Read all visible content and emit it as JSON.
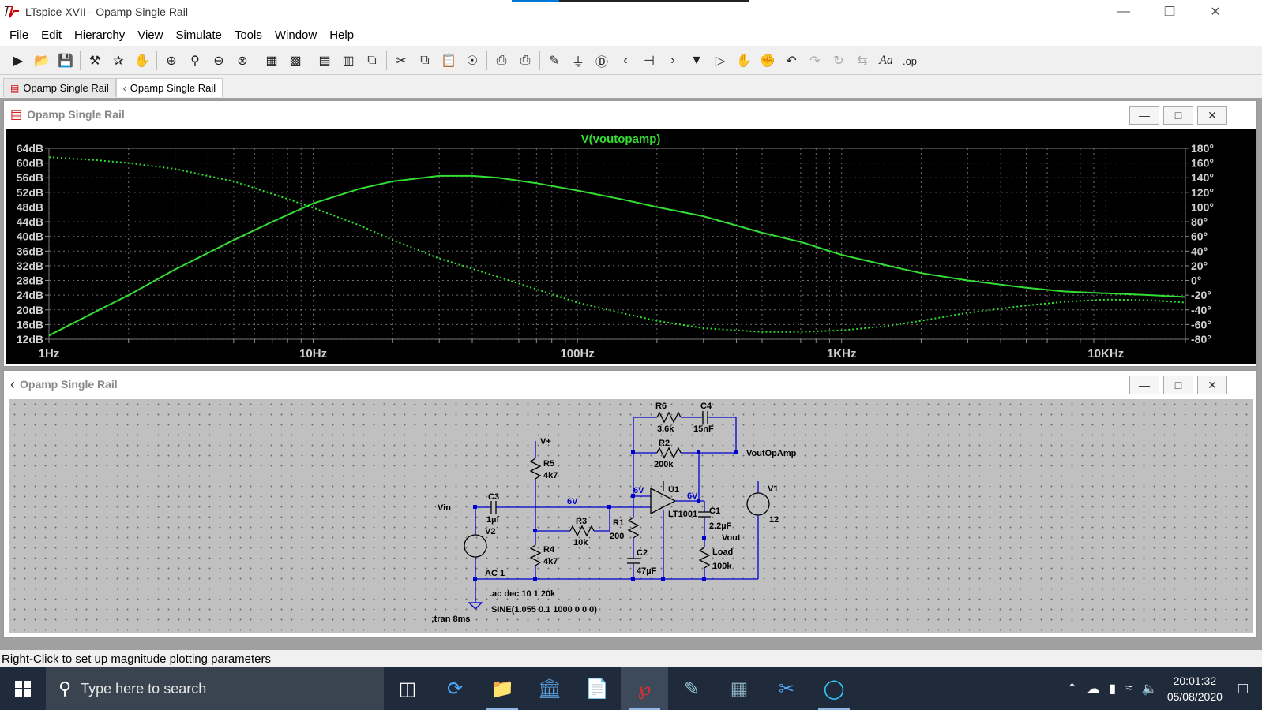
{
  "window": {
    "title": "LTspice XVII - Opamp Single Rail",
    "progress": 0.2
  },
  "menu": [
    "File",
    "Edit",
    "Hierarchy",
    "View",
    "Simulate",
    "Tools",
    "Window",
    "Help"
  ],
  "toolbar_icons": [
    "run-icon",
    "open-icon",
    "save-icon",
    "control-panel-icon",
    "halt-icon",
    "pan-icon",
    "zoom-in-icon",
    "zoom-full-icon",
    "zoom-out-icon",
    "zoom-cancel-icon",
    "autorange-icon",
    "tile-icon",
    "tile-horizontal-icon",
    "tile-vertical-icon",
    "cascade-icon",
    "cut-icon",
    "copy-icon",
    "paste-icon",
    "find-icon",
    "print-preview-icon",
    "print-icon",
    "wire-icon",
    "ground-icon",
    "label-net-icon",
    "resistor-icon",
    "capacitor-icon",
    "inductor-icon",
    "diode-icon",
    "component-icon",
    "move-icon",
    "drag-icon",
    "undo-icon",
    "redo-icon",
    "rotate-icon",
    "mirror-icon",
    "text-icon",
    "spice-directive-icon"
  ],
  "tabs": [
    {
      "label": "Opamp Single Rail",
      "icon": "waveform-tab-icon",
      "active": false
    },
    {
      "label": "Opamp Single Rail",
      "icon": "schematic-tab-icon",
      "active": true
    }
  ],
  "plot_window": {
    "title": "Opamp Single Rail"
  },
  "schematic_window": {
    "title": "Opamp Single Rail"
  },
  "chart_data": {
    "type": "line",
    "title": "V(voutopamp)",
    "x_scale": "log",
    "xlim": [
      1,
      20000
    ],
    "x_tick_labels": [
      "1Hz",
      "10Hz",
      "100Hz",
      "1KHz",
      "10KHz"
    ],
    "x_ticks": [
      1,
      10,
      100,
      1000,
      10000
    ],
    "ylim_left": [
      12,
      64
    ],
    "y_left_labels": [
      "64dB",
      "60dB",
      "56dB",
      "52dB",
      "48dB",
      "44dB",
      "40dB",
      "36dB",
      "32dB",
      "28dB",
      "24dB",
      "20dB",
      "16dB",
      "12dB"
    ],
    "y_left_ticks": [
      64,
      60,
      56,
      52,
      48,
      44,
      40,
      36,
      32,
      28,
      24,
      20,
      16,
      12
    ],
    "ylim_right": [
      -80,
      180
    ],
    "y_right_labels": [
      "180°",
      "160°",
      "140°",
      "120°",
      "100°",
      "80°",
      "60°",
      "40°",
      "20°",
      "0°",
      "-20°",
      "-40°",
      "-60°",
      "-80°"
    ],
    "y_right_ticks": [
      180,
      160,
      140,
      120,
      100,
      80,
      60,
      40,
      20,
      0,
      -20,
      -40,
      -60,
      -80
    ],
    "grid": true,
    "series": [
      {
        "name": "V(voutopamp)",
        "kind": "magnitude (dB)",
        "style": "solid",
        "color": "#33dd33",
        "x": [
          1,
          1.5,
          2,
          3,
          5,
          7,
          10,
          15,
          20,
          30,
          40,
          50,
          70,
          100,
          150,
          200,
          300,
          500,
          700,
          1000,
          1500,
          2000,
          3000,
          5000,
          7000,
          10000,
          15000,
          20000
        ],
        "y": [
          13,
          19.5,
          24,
          31,
          39,
          44,
          49,
          53,
          55,
          56.5,
          56.5,
          56,
          54.5,
          52.5,
          50,
          48,
          45.5,
          41,
          38.5,
          35,
          32,
          30,
          28,
          26,
          25,
          24.5,
          24,
          23.5
        ]
      },
      {
        "name": "V(voutopamp)",
        "kind": "phase (degrees)",
        "style": "dotted",
        "color": "#33dd33",
        "x": [
          1,
          1.5,
          2,
          3,
          5,
          7,
          10,
          15,
          20,
          30,
          50,
          70,
          100,
          150,
          200,
          300,
          500,
          700,
          1000,
          1500,
          2000,
          3000,
          5000,
          7000,
          10000,
          15000,
          20000
        ],
        "y": [
          168,
          164,
          160,
          152,
          135,
          118,
          99,
          75,
          55,
          30,
          5,
          -12,
          -30,
          -45,
          -55,
          -65,
          -70,
          -70,
          -68,
          -62,
          -55,
          -44,
          -34,
          -29,
          -26,
          -27,
          -30
        ]
      }
    ]
  },
  "schematic": {
    "labels": {
      "vin": "Vin",
      "vplus": "V+",
      "vout_opamp": "VoutOpAmp",
      "vout": "Vout",
      "r5": "R5",
      "r5_val": "4k7",
      "r4": "R4",
      "r4_val": "4k7",
      "r3": "R3",
      "r3_val": "10k",
      "r1": "R1",
      "r1_val": "200",
      "r2": "R2",
      "r2_val": "200k",
      "r6": "R6",
      "r6_val": "3.6k",
      "c4": "C4",
      "c4_val": "15nF",
      "c3": "C3",
      "c3_val": "1µf",
      "c2": "C2",
      "c2_val": "47µF",
      "c1": "C1",
      "c1_val": "2.2µF",
      "load": "Load",
      "load_val": "100k",
      "u1": "U1",
      "u1_val": "LT1001",
      "v1": "V1",
      "v1_val": "12",
      "v2": "V2",
      "v2_val": "AC 1",
      "node_6v_a": "6V",
      "node_6v_b": "6V",
      "node_6v_c": "6V",
      "directive_ac": ".ac dec 10 1 20k",
      "directive_sine": "SINE(1.055 0.1 1000 0 0 0)",
      "directive_tran": ";tran 8ms"
    }
  },
  "status": "Right-Click to set up magnitude plotting parameters",
  "taskbar": {
    "search_placeholder": "Type here to search",
    "apps": [
      "task-view-icon",
      "sync-icon",
      "file-explorer-icon",
      "bank-icon",
      "document-icon",
      "ltspice-icon",
      "edit-icon",
      "calculator-icon",
      "snipping-icon",
      "edge-icon"
    ],
    "time": "20:01:32",
    "date": "05/08/2020"
  }
}
